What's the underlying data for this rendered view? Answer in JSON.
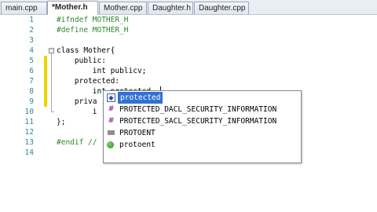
{
  "tabs": [
    {
      "label": "main.cpp",
      "active": false
    },
    {
      "label": "*Mother.h",
      "active": true
    },
    {
      "label": "Mother.cpp",
      "active": false
    },
    {
      "label": "Daughter.h",
      "active": false
    },
    {
      "label": "Daughter.cpp",
      "active": false
    }
  ],
  "gutter": {
    "line_numbers": [
      "1",
      "2",
      "3",
      "4",
      "5",
      "6",
      "7",
      "8",
      "9",
      "10",
      "11",
      "12",
      "13",
      "14"
    ]
  },
  "code": {
    "line1": "#ifndef MOTHER_H",
    "line2": "#define MOTHER_H",
    "line4": "class Mother{",
    "line5": "    public:",
    "line6": "        int publicv;",
    "line7": "    protected:",
    "line8": "        int protected",
    "line9": "    priva",
    "line10": "        i",
    "line11": "};",
    "line13": "#endif //"
  },
  "autocomplete": {
    "items": [
      {
        "label": "protected",
        "icon": "keyword-icon",
        "selected": true
      },
      {
        "label": "PROTECTED_DACL_SECURITY_INFORMATION",
        "icon": "macro-icon",
        "selected": false
      },
      {
        "label": "PROTECTED_SACL_SECURITY_INFORMATION",
        "icon": "macro-icon",
        "selected": false
      },
      {
        "label": "PROTOENT",
        "icon": "typedef-icon",
        "selected": false
      },
      {
        "label": "protoent",
        "icon": "struct-icon",
        "selected": false
      }
    ]
  },
  "colors": {
    "line_number": "#2b8b96",
    "preprocessor": "#2f8a2f",
    "selection": "#3170d4",
    "changed_line_marker": "#f2d300"
  }
}
